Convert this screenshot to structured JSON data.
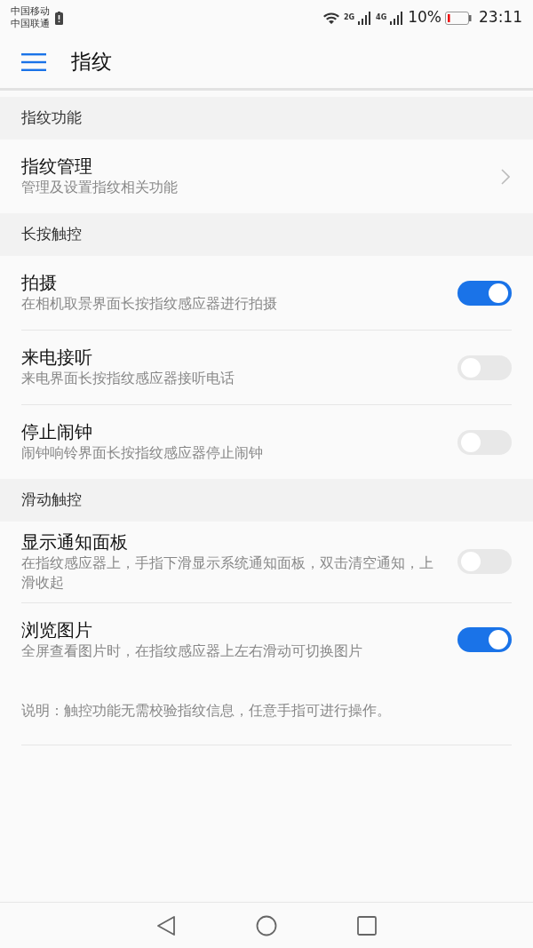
{
  "status_bar": {
    "carriers": [
      "中国移动",
      "中国联通"
    ],
    "networks": [
      "2G",
      "4G"
    ],
    "battery_text": "10%",
    "time": "23:11"
  },
  "header": {
    "title": "指纹"
  },
  "sections": [
    {
      "title": "指纹功能",
      "items": [
        {
          "kind": "link",
          "title": "指纹管理",
          "subtitle": "管理及设置指纹相关功能"
        }
      ]
    },
    {
      "title": "长按触控",
      "items": [
        {
          "kind": "switch",
          "title": "拍摄",
          "subtitle": "在相机取景界面长按指纹感应器进行拍摄",
          "on": true
        },
        {
          "kind": "switch",
          "title": "来电接听",
          "subtitle": "来电界面长按指纹感应器接听电话",
          "on": false
        },
        {
          "kind": "switch",
          "title": "停止闹钟",
          "subtitle": "闹钟响铃界面长按指纹感应器停止闹钟",
          "on": false
        }
      ]
    },
    {
      "title": "滑动触控",
      "items": [
        {
          "kind": "switch",
          "title": "显示通知面板",
          "subtitle": "在指纹感应器上，手指下滑显示系统通知面板，双击清空通知，上滑收起",
          "on": false
        },
        {
          "kind": "switch",
          "title": "浏览图片",
          "subtitle": "全屏查看图片时，在指纹感应器上左右滑动可切换图片",
          "on": true
        }
      ]
    }
  ],
  "note": "说明：触控功能无需校验指纹信息，任意手指可进行操作。"
}
